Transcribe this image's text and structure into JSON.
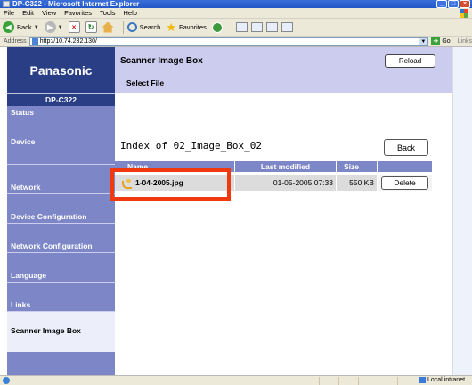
{
  "window": {
    "title": "DP-C322 - Microsoft Internet Explorer",
    "minimize_label": "_",
    "maximize_label": "□",
    "close_label": "×"
  },
  "menu": [
    "File",
    "Edit",
    "View",
    "Favorites",
    "Tools",
    "Help"
  ],
  "toolbar": {
    "back_label": "Back",
    "search_label": "Search",
    "favorites_label": "Favorites"
  },
  "address": {
    "label": "Address",
    "url": "http://10.74.232.130/",
    "go_label": "Go",
    "links_label": "Links"
  },
  "sidebar": {
    "brand": "Panasonic",
    "model": "DP-C322",
    "items": [
      {
        "label": "Status",
        "active": false
      },
      {
        "label": "Device",
        "active": false
      },
      {
        "label": "Network",
        "active": false
      },
      {
        "label": "Device Configuration",
        "active": false
      },
      {
        "label": "Network Configuration",
        "active": false
      },
      {
        "label": "Language",
        "active": false
      },
      {
        "label": "Links",
        "active": false
      },
      {
        "label": "Scanner Image Box",
        "active": true
      }
    ]
  },
  "header": {
    "title": "Scanner Image Box",
    "subtitle": "Select File",
    "reload_label": "Reload"
  },
  "listing": {
    "heading": "Index of 02_Image_Box_02",
    "back_label": "Back",
    "columns": {
      "name": "Name",
      "modified": "Last modified",
      "size": "Size"
    },
    "rows": [
      {
        "name": "1-04-2005.jpg",
        "modified": "01-05-2005 07:33",
        "size": "550 KB",
        "action": "Delete"
      }
    ]
  },
  "statusbar": {
    "zone": "Local intranet"
  },
  "colors": {
    "nav_bg": "#7d86c6",
    "panel_bg": "#ccccee",
    "brand_bg": "#2a3e86",
    "highlight": "#f03a0e"
  }
}
